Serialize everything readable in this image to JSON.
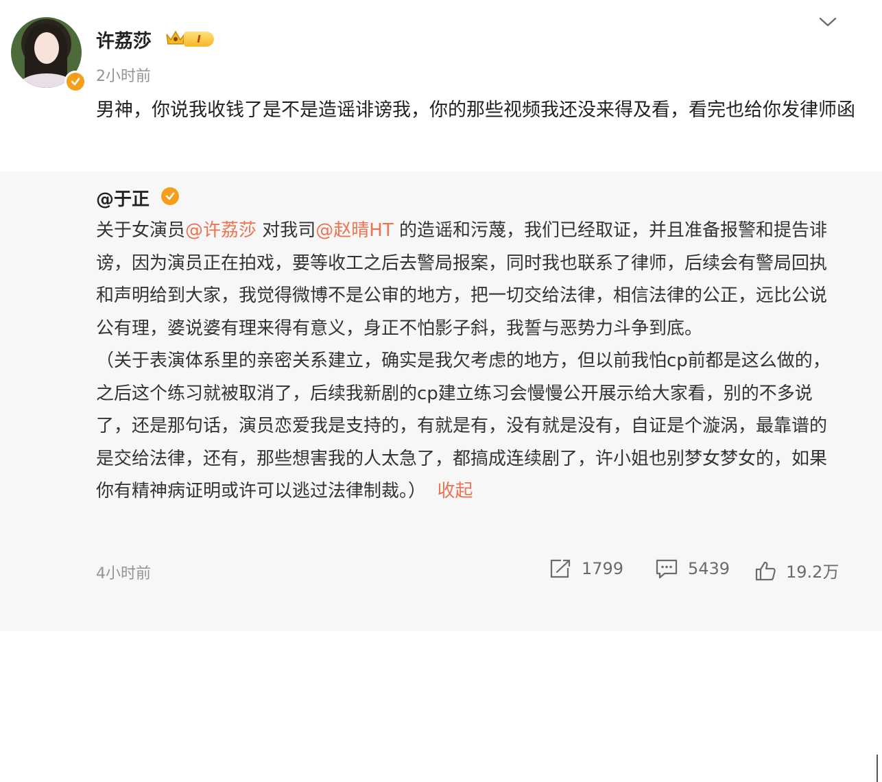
{
  "post": {
    "username": "许荔莎",
    "level": "I",
    "time": "2小时前",
    "text": "男神，你说我收钱了是不是造谣诽谤我，你的那些视频我还没来得及看，看完也给你发律师函"
  },
  "repost": {
    "author": "@于正",
    "text_segments": [
      "关于女演员",
      "@许荔莎",
      " 对我司",
      "@赵晴HT",
      " 的造谣和污蔑，我们已经取证，并且准备报警和提告诽谤，因为演员正在拍戏，要等收工之后去警局报案，同时我也联系了律师，后续会有警局回执和声明给到大家，我觉得微博不是公审的地方，把一切交给法律，相信法律的公正，远比公说公有理，婆说婆有理来得有意义，身正不怕影子斜，我誓与恶势力斗争到底。",
      "（关于表演体系里的亲密关系建立，确实是我欠考虑的地方，但以前我怕cp前都是这么做的，之后这个练习就被取消了，后续我新剧的cp建立练习会慢慢公开展示给大家看，别的不多说了，还是那句话，演员恋爱我是支持的，有就是有，没有就是没有，自证是个漩涡，最靠谱的是交给法律，还有，那些想害我的人太急了，都搞成连续剧了，许小姐也别梦女梦女的，如果你有精神病证明或许可以逃过法律制裁。）"
    ],
    "collapse_label": "收起",
    "time": "4小时前",
    "actions": {
      "repost_count": "1799",
      "comment_count": "5439",
      "like_count": "19.2万"
    }
  },
  "colors": {
    "mention": "#eb7350",
    "verified_badge": "#f59e1c",
    "repost_bg": "#f7f7f7",
    "meta_text": "#939393"
  },
  "icons": [
    "chevron-down-icon",
    "crown-icon",
    "verified-icon",
    "repost-icon",
    "comment-icon",
    "like-icon"
  ]
}
